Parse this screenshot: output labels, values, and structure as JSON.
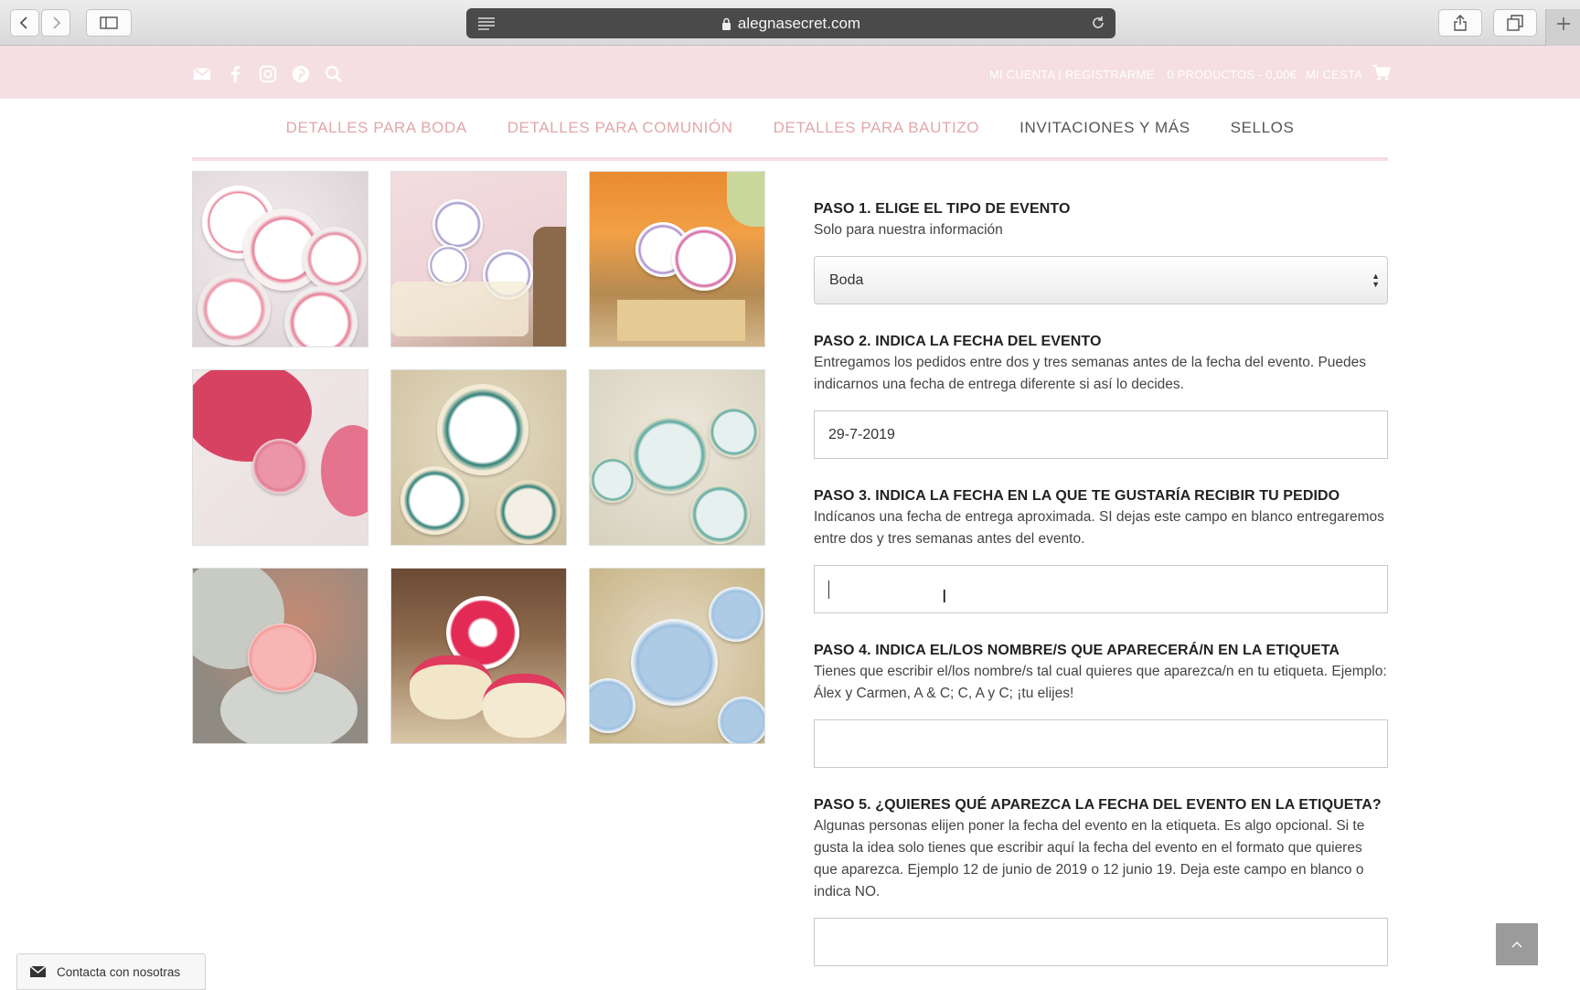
{
  "browser": {
    "url": "alegnasecret.com"
  },
  "header": {
    "account_label": "MI CUENTA | REGISTRARME",
    "cart_summary": "0 PRODUCTOS - 0,00€",
    "cart_label": "MI CESTA"
  },
  "nav": {
    "items": [
      {
        "label": "DETALLES PARA BODA"
      },
      {
        "label": "DETALLES PARA COMUNIÓN"
      },
      {
        "label": "DETALLES PARA BAUTIZO"
      },
      {
        "label": "INVITACIONES Y MÁS"
      },
      {
        "label": "SELLOS"
      }
    ]
  },
  "form": {
    "step1": {
      "title": "PASO 1. ELIGE EL TIPO DE EVENTO",
      "desc": "Solo para nuestra información",
      "selected": "Boda"
    },
    "step2": {
      "title": "PASO 2. INDICA LA FECHA DEL EVENTO",
      "desc": "Entregamos los pedidos entre dos y tres semanas antes de la fecha del evento. Puedes indicarnos una fecha de entrega diferente si así lo decides.",
      "value": "29-7-2019"
    },
    "step3": {
      "title": "PASO 3. INDICA LA FECHA EN LA QUE TE GUSTARÍA RECIBIR TU PEDIDO",
      "desc": "Indícanos una fecha de entrega aproximada. SI dejas este campo en blanco entregaremos entre dos y tres semanas antes del evento.",
      "value": ""
    },
    "step4": {
      "title": "PASO 4. INDICA EL/LOS NOMBRE/S QUE APARECERÁ/N EN LA ETIQUETA",
      "desc": "Tienes que escribir el/los nombre/s tal cual quieres que aparezca/n en tu etiqueta. Ejemplo: Álex y Carmen, A & C; C, A y C; ¡tu elijes!",
      "value": ""
    },
    "step5": {
      "title": "PASO 5. ¿QUIERES QUÉ APAREZCA LA FECHA DEL EVENTO EN LA ETIQUETA?",
      "desc": "Algunas personas elijen poner la fecha del evento en la etiqueta. Es algo opcional. Si te gusta la idea solo tienes que escribir aquí la fecha del evento en el formato que quieres que aparezca. Ejemplo 12 de junio de 2019 o 12 junio 19. Deja este campo en blanco o indica NO.",
      "value": ""
    }
  },
  "contact_label": "Contacta con nosotras",
  "colors": {
    "header_bg": "#f5dfe2",
    "nav_pink": "#e2a7a9",
    "nav_dark": "#555555"
  }
}
